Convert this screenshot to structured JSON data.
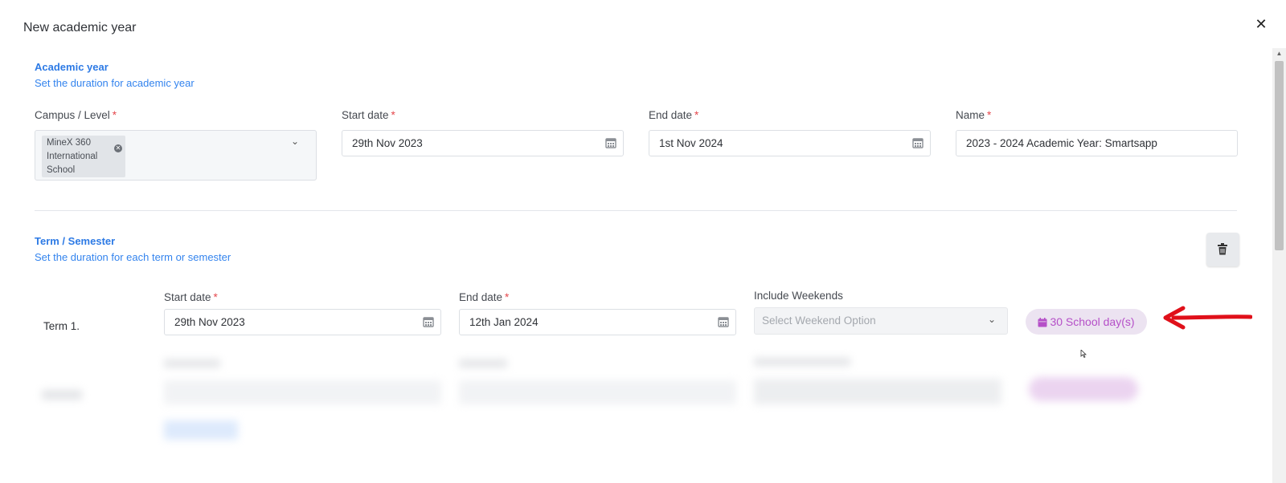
{
  "modal": {
    "title": "New academic year",
    "close_icon": "close-icon"
  },
  "academic_year": {
    "title": "Academic year",
    "subtitle": "Set the duration for academic year",
    "campus_label": "Campus / Level",
    "campus_chip": "MineX 360 International School",
    "start_label": "Start date",
    "start_value": "29th Nov 2023",
    "end_label": "End date",
    "end_value": "1st Nov 2024",
    "name_label": "Name",
    "name_value": "2023 - 2024 Academic Year: Smartsapp",
    "required_mark": "*"
  },
  "term": {
    "title": "Term / Semester",
    "subtitle": "Set the duration for each term or semester",
    "row_label": "Term 1.",
    "start_label": "Start date",
    "start_value": "29th Nov 2023",
    "end_label": "End date",
    "end_value": "12th Jan 2024",
    "weekends_label": "Include Weekends",
    "weekends_placeholder": "Select Weekend Option",
    "school_days": "30 School day(s)"
  },
  "colors": {
    "accent": "#2d7ae5",
    "required": "#e5484d",
    "badge_bg": "#ece3f1",
    "badge_text": "#b54fc8",
    "annotation_arrow": "#e0101a"
  }
}
